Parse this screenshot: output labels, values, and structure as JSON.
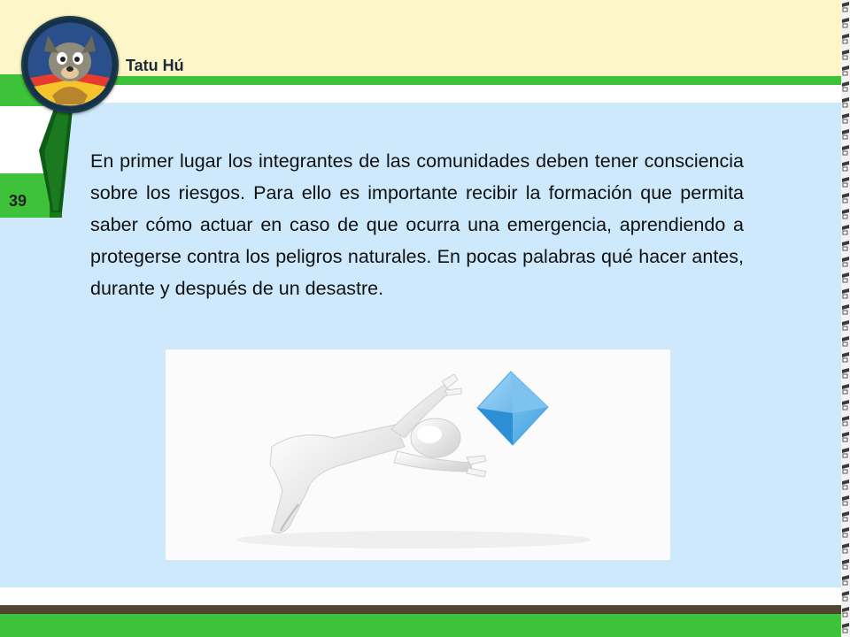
{
  "header": {
    "brand_name": "Tatu Hú"
  },
  "page": {
    "number": "39"
  },
  "content": {
    "paragraph": "En primer lugar los integrantes de las comunidades deben tener consciencia sobre los riesgos. Para ello es importante recibir la formación que permita saber cómo actuar en caso de que ocurra una emergencia, aprendiendo a protegerse contra los peligros naturales. En pocas palabras qué hacer antes, durante y después de un desastre."
  },
  "icons": {
    "logo": "armadillo-mascot-icon",
    "illustration": "figure-reaching-for-kite-icon",
    "binding": "spiral-binding-icon"
  },
  "colors": {
    "accent_green": "#3ec23a",
    "header_cream": "#fdf6c8",
    "panel_blue": "#cde9fb",
    "footer_brown": "#4f4530"
  }
}
